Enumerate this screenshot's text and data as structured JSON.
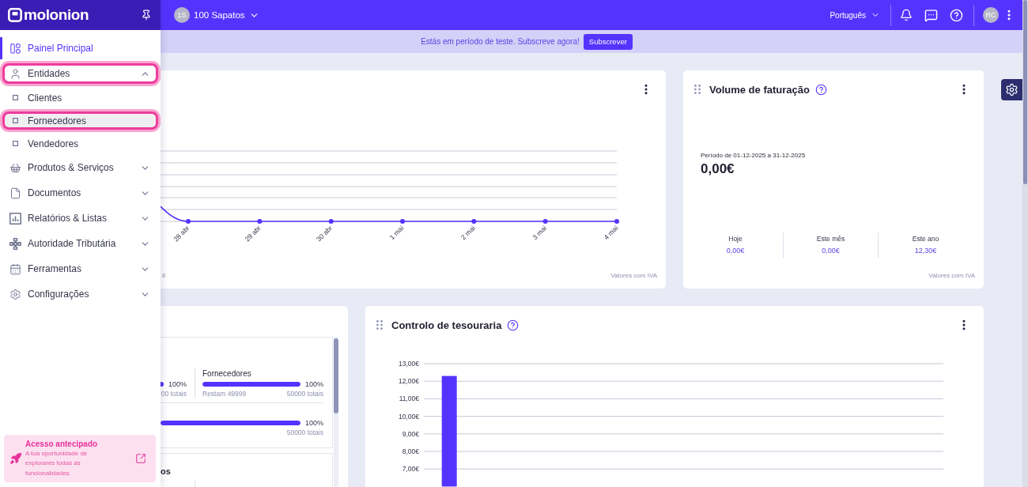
{
  "sidebar": {
    "logo": "molonion",
    "items": [
      {
        "label": "Painel Principal",
        "selected": true,
        "highlighted": false
      },
      {
        "label": "Entidades",
        "selected": false,
        "highlighted": true,
        "expanded": true,
        "children": [
          {
            "label": "Clientes",
            "selected": false,
            "hovered": false,
            "highlighted": false
          },
          {
            "label": "Fornecedores",
            "selected": false,
            "hovered": true,
            "highlighted": true
          },
          {
            "label": "Vendedores",
            "selected": false,
            "hovered": false,
            "highlighted": false
          }
        ]
      },
      {
        "label": "Produtos & Serviços",
        "selected": false,
        "highlighted": false,
        "expanded": false
      },
      {
        "label": "Documentos",
        "selected": false,
        "highlighted": false,
        "expanded": false
      },
      {
        "label": "Relatórios & Listas",
        "selected": false,
        "highlighted": false,
        "expanded": false
      },
      {
        "label": "Autoridade Tributária",
        "selected": false,
        "highlighted": false,
        "expanded": false
      },
      {
        "label": "Ferramentas",
        "selected": false,
        "highlighted": false,
        "expanded": false
      },
      {
        "label": "Configurações",
        "selected": false,
        "highlighted": false,
        "expanded": false
      }
    ],
    "promo": {
      "title": "Acesso antecipado",
      "text": "A tua oportunidade de explorares todas as funcionalidades."
    }
  },
  "topbar": {
    "company_initials": "1S",
    "company": "100 Sapatos",
    "language": "Português",
    "user_initials": "RC"
  },
  "banner": {
    "text": "Estás em período de teste. Subscreve agora!",
    "button": "Subscrever"
  },
  "sales_card": {
    "x_labels": [
      "28 abr",
      "29 abr",
      "30 abr",
      "1 mai",
      "2 mai",
      "3 mai",
      "4 mai"
    ],
    "note": "6",
    "footnote": "Valores com IVA"
  },
  "billing_card": {
    "title": "Volume de faturação",
    "period": "Período de 01-12-2025 a 31-12-2025",
    "total": "0,00€",
    "stats": [
      {
        "label": "Hoje",
        "value": "0,00€"
      },
      {
        "label": "Este mês",
        "value": "0,00€"
      },
      {
        "label": "Este ano",
        "value": "12,30€"
      }
    ],
    "footnote": "Valores com IVA"
  },
  "usage_card": {
    "sections": [
      {
        "groups": [
          {
            "kind": "split",
            "meters": [
              {
                "percent": "100%",
                "total": "00 totais"
              },
              {
                "label": "Fornecedores",
                "level": 1,
                "percent": "100%",
                "remaining": "Restam 49999",
                "total": "50000 totais"
              }
            ]
          },
          {
            "kind": "wide",
            "meters": [
              {
                "level": 1,
                "percent": "100%",
                "total": "50000 totais"
              }
            ]
          }
        ]
      },
      {
        "title": "os"
      }
    ]
  },
  "treasury_card": {
    "title": "Controlo de tesouraria",
    "chart_data": {
      "type": "bar",
      "values": [
        12.3,
        null,
        null,
        null,
        null,
        null,
        null,
        null,
        null,
        null,
        null,
        null
      ],
      "ylim": [
        6,
        13
      ],
      "yticks": [
        {
          "value": 13,
          "label": "13,00€"
        },
        {
          "value": 12,
          "label": "12,00€"
        },
        {
          "value": 11,
          "label": "11,00€"
        },
        {
          "value": 10,
          "label": "10,00€"
        },
        {
          "value": 9,
          "label": "9,00€"
        },
        {
          "value": 8,
          "label": "8,00€"
        },
        {
          "value": 7,
          "label": "7,00€"
        }
      ],
      "grid": true
    }
  }
}
